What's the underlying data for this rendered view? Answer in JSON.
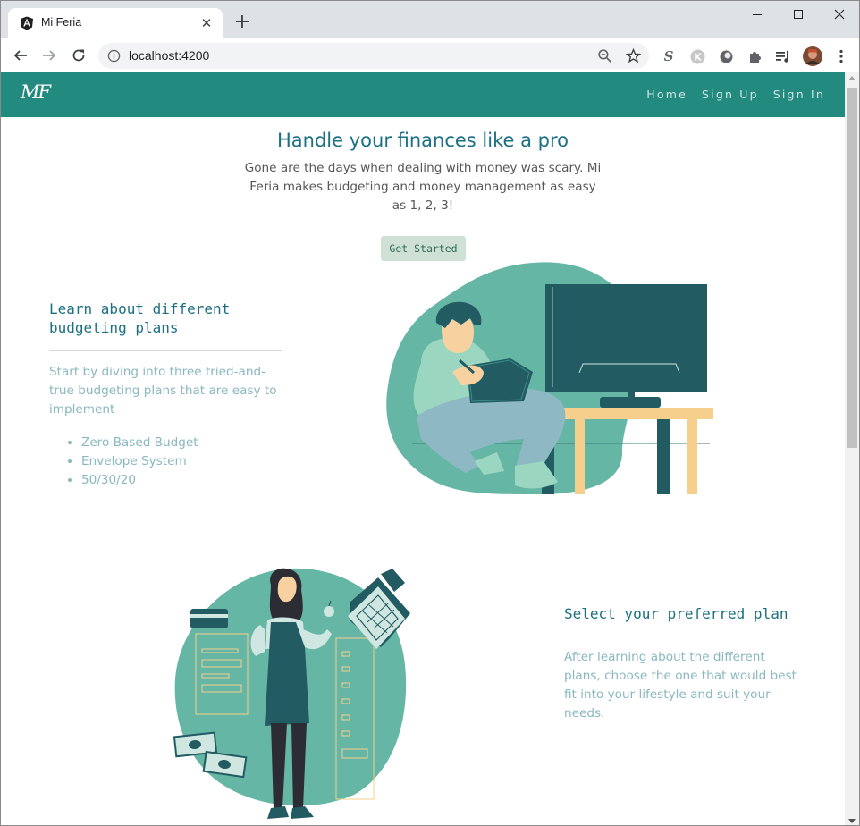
{
  "browser": {
    "tab_title": "Mi Feria",
    "tab_close": "✕",
    "new_tab": "+",
    "url": "localhost:4200"
  },
  "navbar": {
    "brand": "MF",
    "links": [
      "Home",
      "Sign Up",
      "Sign In"
    ]
  },
  "hero": {
    "title": "Handle your finances like a pro",
    "subtitle": "Gone are the days when dealing with money was scary. Mi Feria makes budgeting and money management as easy as 1, 2, 3!",
    "cta_label": "Get Started"
  },
  "section_learn": {
    "title": "Learn about different budgeting plans",
    "text": "Start by diving into three tried-and-true budgeting plans that are easy to implement",
    "plans": [
      "Zero Based Budget",
      "Envelope System",
      "50/30/20"
    ]
  },
  "section_select": {
    "title": "Select your preferred plan",
    "text": "After learning about the different plans, choose the one that would best fit into your lifestyle and suit your needs."
  },
  "colors": {
    "navbar": "#238a80",
    "title_teal": "#1b7086",
    "muted_text": "#89b8c0",
    "button_bg": "#cfe1d4",
    "illustration_blob": "#66b6a5",
    "illustration_dark": "#235b63",
    "illustration_wood": "#f7cf8d"
  }
}
